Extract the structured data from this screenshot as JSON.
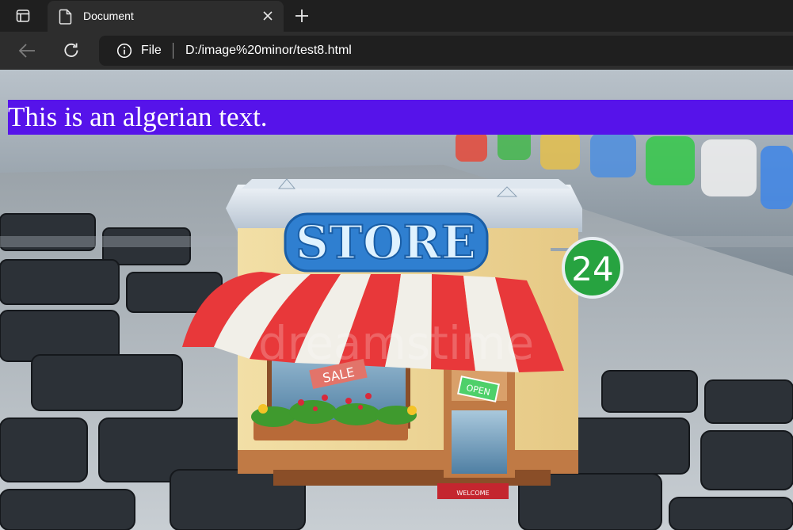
{
  "browser": {
    "tab": {
      "title": "Document"
    },
    "address_bar": {
      "scheme_label": "File",
      "url": "D:/image%20minor/test8.html"
    },
    "icons": {
      "tab_actions": "tab-actions-icon",
      "document": "document-icon",
      "close": "close-icon",
      "new_tab": "plus-icon",
      "back": "arrow-left-icon",
      "reload": "reload-icon",
      "info": "info-icon"
    }
  },
  "page": {
    "heading_text": "This is an algerian text.",
    "heading_background": "#5613ea",
    "image": {
      "sign_text": "STORE",
      "badge_text": "24",
      "sale_tag": "SALE",
      "open_sign": "OPEN",
      "mat_text": "WELCOME",
      "watermark": "dreamstime"
    }
  }
}
